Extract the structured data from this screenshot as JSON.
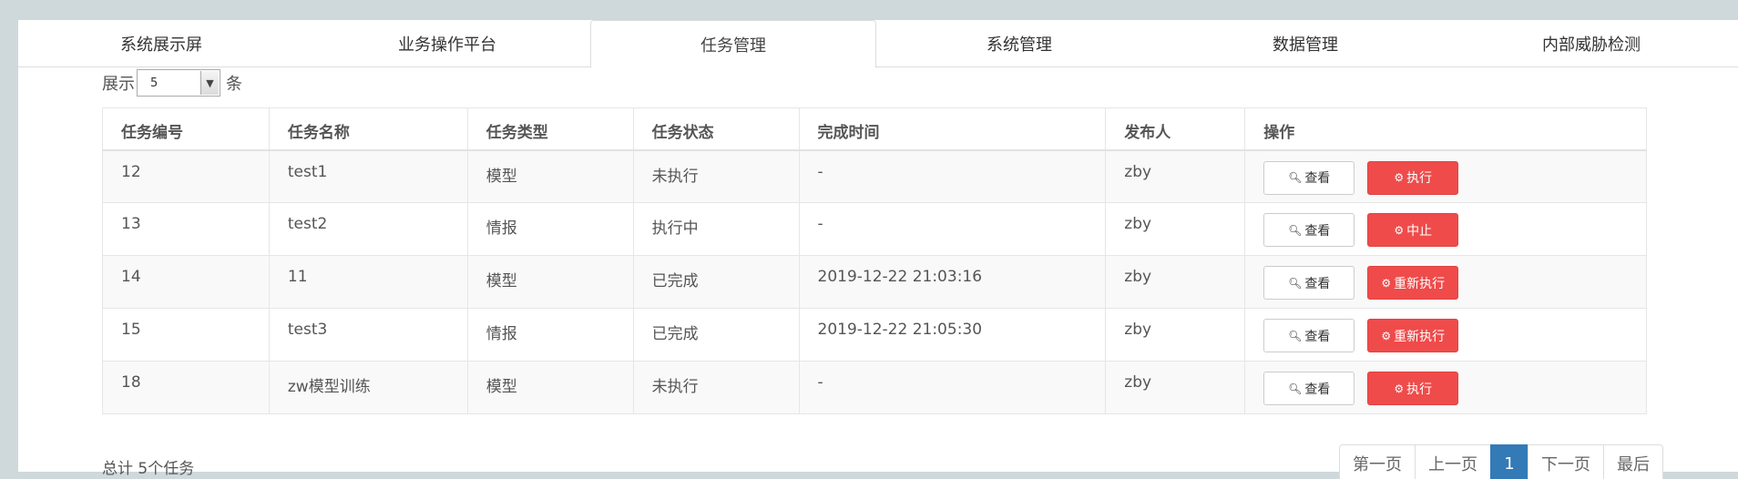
{
  "tabs": [
    {
      "label": "系统展示屏",
      "active": false
    },
    {
      "label": "业务操作平台",
      "active": false
    },
    {
      "label": "任务管理",
      "active": true
    },
    {
      "label": "系统管理",
      "active": false
    },
    {
      "label": "数据管理",
      "active": false
    },
    {
      "label": "内部威胁检测",
      "active": false
    }
  ],
  "page_size": {
    "prefix": "展示",
    "value": "5",
    "suffix": "条"
  },
  "table": {
    "headers": [
      "任务编号",
      "任务名称",
      "任务类型",
      "任务状态",
      "完成时间",
      "发布人",
      "操作"
    ],
    "rows": [
      {
        "id": "12",
        "name": "test1",
        "type": "模型",
        "status": "未执行",
        "time": "-",
        "publisher": "zby",
        "view_label": "查看",
        "action_label": "执行"
      },
      {
        "id": "13",
        "name": "test2",
        "type": "情报",
        "status": "执行中",
        "time": "-",
        "publisher": "zby",
        "view_label": "查看",
        "action_label": "中止"
      },
      {
        "id": "14",
        "name": "11",
        "type": "模型",
        "status": "已完成",
        "time": "2019-12-22 21:03:16",
        "publisher": "zby",
        "view_label": "查看",
        "action_label": "重新执行"
      },
      {
        "id": "15",
        "name": "test3",
        "type": "情报",
        "status": "已完成",
        "time": "2019-12-22 21:05:30",
        "publisher": "zby",
        "view_label": "查看",
        "action_label": "重新执行"
      },
      {
        "id": "18",
        "name": "zw模型训练",
        "type": "模型",
        "status": "未执行",
        "time": "-",
        "publisher": "zby",
        "view_label": "查看",
        "action_label": "执行"
      }
    ]
  },
  "footer": {
    "total": "总计 5个任务"
  },
  "pager": {
    "first": "第一页",
    "prev": "上一页",
    "current": "1",
    "next": "下一页",
    "last": "最后"
  },
  "icons": {
    "view": "search-icon",
    "action": "gear-icon"
  },
  "colors": {
    "danger": "#ef4b4b",
    "primary": "#337ab7"
  }
}
